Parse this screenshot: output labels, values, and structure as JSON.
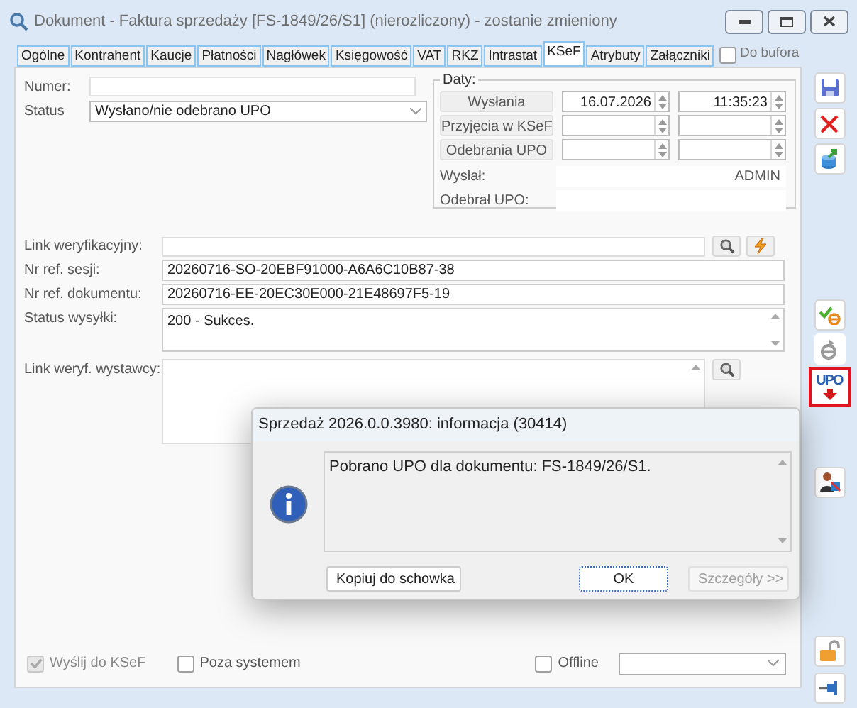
{
  "window": {
    "title": "Dokument - Faktura sprzedaży [FS-1849/26/S1] (nierozliczony) - zostanie zmieniony"
  },
  "tabs": [
    {
      "label": "Ogólne",
      "selected": false
    },
    {
      "label": "Kontrahent",
      "selected": false
    },
    {
      "label": "Kaucje",
      "selected": false
    },
    {
      "label": "Płatności",
      "selected": false
    },
    {
      "label": "Nagłówek",
      "selected": false
    },
    {
      "label": "Księgowość",
      "selected": false
    },
    {
      "label": "VAT",
      "selected": false
    },
    {
      "label": "RKZ",
      "selected": false
    },
    {
      "label": "Intrastat",
      "selected": false
    },
    {
      "label": "KSeF",
      "selected": true
    },
    {
      "label": "Atrybuty",
      "selected": false
    },
    {
      "label": "Załączniki",
      "selected": false
    }
  ],
  "do_bufora": {
    "label": "Do bufora",
    "checked": false
  },
  "numer": {
    "label": "Numer:"
  },
  "status": {
    "label": "Status",
    "value": "Wysłano/nie odebrano UPO"
  },
  "daty": {
    "title": "Daty:",
    "rows": [
      {
        "label": "Wysłania",
        "date": "16.07.2026",
        "time": "11:35:23"
      },
      {
        "label": "Przyjęcia w KSeF"
      },
      {
        "label": "Odebrania UPO"
      }
    ],
    "wyslal": {
      "label": "Wysłał:",
      "value": "ADMIN"
    },
    "odebral_upo": {
      "label": "Odebrał UPO:"
    }
  },
  "fields": [
    {
      "kind": "link",
      "label": "Link weryfikacyjny:"
    },
    {
      "kind": "text",
      "label": "Nr ref. sesji:",
      "value": "20260716-SO-20EBF91000-A6A6C10B87-38"
    },
    {
      "kind": "text",
      "label": "Nr ref. dokumentu:",
      "value": "20260716-EE-20EC30E000-21E48697F5-19"
    },
    {
      "kind": "memo",
      "label": "Status wysyłki:",
      "value": "200 - Sukces."
    },
    {
      "kind": "memo_link",
      "label": "Link weryf. wystawcy:"
    }
  ],
  "footer": {
    "checkboxes": [
      {
        "label": "Wyślij do KSeF",
        "checked": true,
        "disabled": true
      },
      {
        "label": "Poza systemem",
        "checked": false,
        "disabled": false
      }
    ],
    "offline": {
      "label": "Offline",
      "checked": false
    }
  },
  "upo_button": {
    "label": "UPO",
    "highlighted": true
  },
  "dialog": {
    "title": "Sprzedaż 2026.0.0.3980: informacja (30414)",
    "message": "Pobrano UPO dla dokumentu: FS-1849/26/S1.",
    "buttons": [
      {
        "label": "Kopiuj do schowka",
        "default": false,
        "disabled": false
      },
      {
        "label": "OK",
        "default": true,
        "disabled": false
      },
      {
        "label": "Szczegóły >>",
        "default": false,
        "disabled": true
      }
    ]
  }
}
